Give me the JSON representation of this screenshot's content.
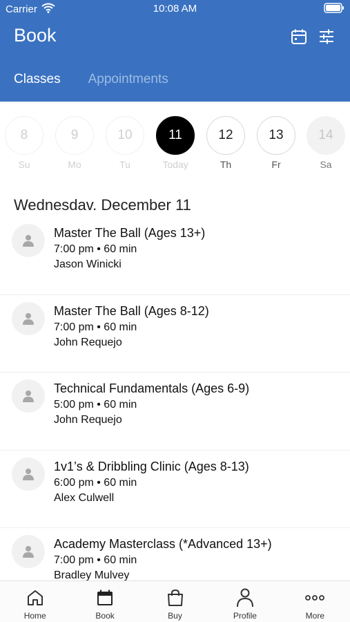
{
  "status_bar": {
    "carrier": "Carrier",
    "time": "10:08 AM"
  },
  "header": {
    "title": "Book",
    "tabs": [
      {
        "label": "Classes",
        "active": true
      },
      {
        "label": "Appointments",
        "active": false
      }
    ]
  },
  "date_strip": [
    {
      "num": "8",
      "weekday": "Su",
      "state": "faded"
    },
    {
      "num": "9",
      "weekday": "Mo",
      "state": "faded"
    },
    {
      "num": "10",
      "weekday": "Tu",
      "state": "faded"
    },
    {
      "num": "11",
      "weekday": "Today",
      "state": "selected"
    },
    {
      "num": "12",
      "weekday": "Th",
      "state": "normal"
    },
    {
      "num": "13",
      "weekday": "Fr",
      "state": "normal"
    },
    {
      "num": "14",
      "weekday": "Sa",
      "state": "disabled"
    }
  ],
  "date_heading": "Wednesdav. December 11",
  "classes": [
    {
      "name": "Master The Ball (Ages 13+)",
      "time": "7:00 pm • 60 min",
      "instructor": "Jason Winicki"
    },
    {
      "name": "Master The Ball (Ages 8-12)",
      "time": "7:00 pm • 60 min",
      "instructor": "John Requejo"
    },
    {
      "name": "Technical Fundamentals (Ages 6-9)",
      "time": "5:00 pm • 60 min",
      "instructor": "John Requejo"
    },
    {
      "name": "1v1’s & Dribbling Clinic (Ages 8-13)",
      "time": "6:00 pm • 60 min",
      "instructor": "Alex Culwell"
    },
    {
      "name": "Academy Masterclass (*Advanced 13+)",
      "time": "7:00 pm • 60 min",
      "instructor": "Bradley Mulvey"
    }
  ],
  "bottom_nav": [
    {
      "label": "Home",
      "icon": "home-icon"
    },
    {
      "label": "Book",
      "icon": "calendar-icon"
    },
    {
      "label": "Buy",
      "icon": "shopping-bag-icon"
    },
    {
      "label": "Profile",
      "icon": "profile-icon"
    },
    {
      "label": "More",
      "icon": "more-icon"
    }
  ],
  "colors": {
    "header_bg": "#3a72c1",
    "selected_day": "#000000"
  }
}
